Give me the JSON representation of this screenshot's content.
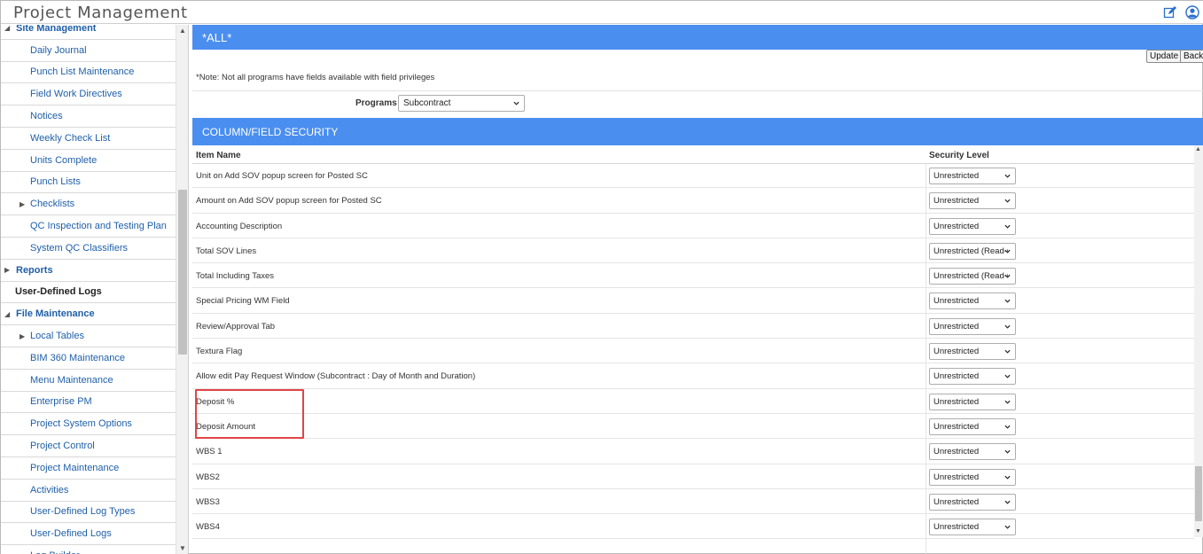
{
  "app": {
    "title": "Project Management"
  },
  "header_icons": [
    "edit-icon",
    "user-circle-icon"
  ],
  "sidebar": {
    "items": [
      {
        "label": "Site Management",
        "level": 0,
        "arrow": "expanded"
      },
      {
        "label": "Daily Journal",
        "level": 1
      },
      {
        "label": "Punch List Maintenance",
        "level": 1
      },
      {
        "label": "Field Work Directives",
        "level": 1
      },
      {
        "label": "Notices",
        "level": 1
      },
      {
        "label": "Weekly Check List",
        "level": 1
      },
      {
        "label": "Units Complete",
        "level": 1
      },
      {
        "label": "Punch Lists",
        "level": 1
      },
      {
        "label": "Checklists",
        "level": 1,
        "arrow": "collapsed"
      },
      {
        "label": "QC Inspection and Testing Plan",
        "level": 1
      },
      {
        "label": "System QC Classifiers",
        "level": 1
      },
      {
        "label": "Reports",
        "level": 0,
        "arrow": "collapsed"
      },
      {
        "label": "User-Defined Logs",
        "level": 0,
        "dark": true
      },
      {
        "label": "File Maintenance",
        "level": 0,
        "arrow": "expanded"
      },
      {
        "label": "Local Tables",
        "level": 1,
        "arrow": "collapsed"
      },
      {
        "label": "BIM 360 Maintenance",
        "level": 1
      },
      {
        "label": "Menu Maintenance",
        "level": 1
      },
      {
        "label": "Enterprise PM",
        "level": 1
      },
      {
        "label": "Project System Options",
        "level": 1
      },
      {
        "label": "Project Control",
        "level": 1
      },
      {
        "label": "Project Maintenance",
        "level": 1
      },
      {
        "label": "Activities",
        "level": 1
      },
      {
        "label": "User-Defined Log Types",
        "level": 1
      },
      {
        "label": "User-Defined Logs",
        "level": 1
      },
      {
        "label": "Log Builder",
        "level": 1
      }
    ]
  },
  "main": {
    "banner": "*ALL*",
    "note": "*Note: Not all programs have fields available with field privileges",
    "update_label": "Update",
    "back_label": "Back",
    "programs_label": "Programs",
    "programs_value": "Subcontract",
    "section_title": "COLUMN/FIELD SECURITY",
    "columns": {
      "item_name": "Item Name",
      "security_level": "Security Level"
    },
    "rows": [
      {
        "name": "Unit on Add SOV popup screen for Posted SC",
        "security": "Unrestricted"
      },
      {
        "name": "Amount on Add SOV popup screen for Posted SC",
        "security": "Unrestricted"
      },
      {
        "name": "Accounting Description",
        "security": "Unrestricted"
      },
      {
        "name": "Total SOV Lines",
        "security": "Unrestricted (Read-Only)"
      },
      {
        "name": "Total Including Taxes",
        "security": "Unrestricted (Read-Only)"
      },
      {
        "name": "Special Pricing WM Field",
        "security": "Unrestricted"
      },
      {
        "name": "Review/Approval Tab",
        "security": "Unrestricted"
      },
      {
        "name": "Textura Flag",
        "security": "Unrestricted"
      },
      {
        "name": "Allow edit Pay Request Window (Subcontract : Day of Month and Duration)",
        "security": "Unrestricted"
      },
      {
        "name": "Deposit %",
        "security": "Unrestricted"
      },
      {
        "name": "Deposit Amount",
        "security": "Unrestricted"
      },
      {
        "name": "WBS 1",
        "security": "Unrestricted"
      },
      {
        "name": "WBS2",
        "security": "Unrestricted"
      },
      {
        "name": "WBS3",
        "security": "Unrestricted"
      },
      {
        "name": "WBS4",
        "security": "Unrestricted"
      }
    ]
  },
  "colors": {
    "accent_bar": "#4a8ef0",
    "link": "#1f5fa8",
    "highlight_box": "#e04545"
  }
}
